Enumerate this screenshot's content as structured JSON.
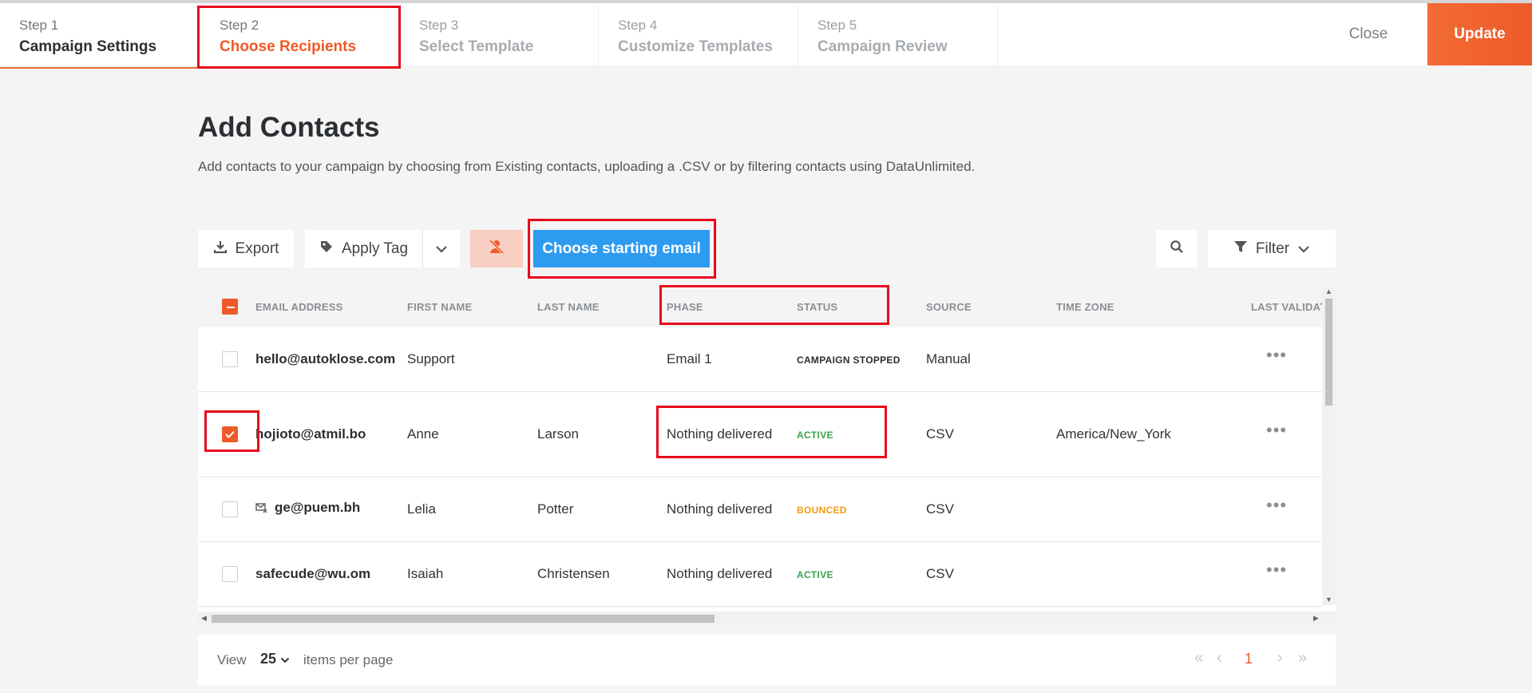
{
  "stepper": {
    "steps": [
      {
        "num": "Step 1",
        "label": "Campaign Settings"
      },
      {
        "num": "Step 2",
        "label": "Choose Recipients"
      },
      {
        "num": "Step 3",
        "label": "Select Template"
      },
      {
        "num": "Step 4",
        "label": "Customize Templates"
      },
      {
        "num": "Step 5",
        "label": "Campaign Review"
      }
    ],
    "close_label": "Close",
    "update_label": "Update"
  },
  "header": {
    "title": "Add Contacts",
    "description": "Add contacts to your campaign by choosing from Existing contacts, uploading a .CSV or by filtering contacts using DataUnlimited."
  },
  "toolbar": {
    "export_label": "Export",
    "apply_tag_label": "Apply Tag",
    "choose_email_label": "Choose starting email",
    "filter_label": "Filter"
  },
  "table": {
    "columns": [
      "EMAIL ADDRESS",
      "FIRST NAME",
      "LAST NAME",
      "PHASE",
      "STATUS",
      "SOURCE",
      "TIME ZONE",
      "LAST VALIDAT"
    ],
    "rows": [
      {
        "email": "hello@autoklose.com",
        "first": "Support",
        "last": "",
        "phase": "Email 1",
        "status": "CAMPAIGN STOPPED",
        "source": "Manual",
        "timezone": ""
      },
      {
        "email": "hojioto@atmil.bo",
        "first": "Anne",
        "last": "Larson",
        "phase": "Nothing delivered",
        "status": "ACTIVE",
        "source": "CSV",
        "timezone": "America/New_York"
      },
      {
        "email": "ge@puem.bh",
        "first": "Lelia",
        "last": "Potter",
        "phase": "Nothing delivered",
        "status": "BOUNCED",
        "source": "CSV",
        "timezone": ""
      },
      {
        "email": "safecude@wu.om",
        "first": "Isaiah",
        "last": "Christensen",
        "phase": "Nothing delivered",
        "status": "ACTIVE",
        "source": "CSV",
        "timezone": ""
      }
    ]
  },
  "footer": {
    "view_label": "View",
    "per_page": "25",
    "per_page_label": "items per page",
    "current_page": "1"
  },
  "colors": {
    "accent": "#ef5a24",
    "primary_button": "#2d9bf0",
    "active_status": "#3aa34a",
    "bounced_status": "#f39c12",
    "annotation": "#e8081c"
  }
}
